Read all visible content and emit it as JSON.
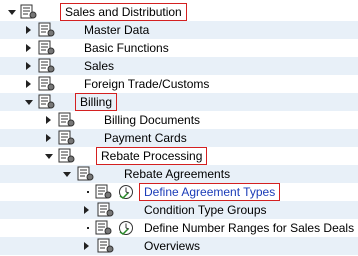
{
  "tree": [
    {
      "label": "Sales and Distribution",
      "level": 0,
      "toggle": "down",
      "boxed": true
    },
    {
      "label": "Master Data",
      "level": 1,
      "toggle": "right"
    },
    {
      "label": "Basic Functions",
      "level": 1,
      "toggle": "right"
    },
    {
      "label": "Sales",
      "level": 1,
      "toggle": "right"
    },
    {
      "label": "Foreign Trade/Customs",
      "level": 1,
      "toggle": "right"
    },
    {
      "label": "Billing",
      "level": 1,
      "toggle": "down",
      "boxed": true
    },
    {
      "label": "Billing Documents",
      "level": 2,
      "toggle": "right"
    },
    {
      "label": "Payment Cards",
      "level": 2,
      "toggle": "right"
    },
    {
      "label": "Rebate Processing",
      "level": 2,
      "toggle": "down",
      "boxed": true
    },
    {
      "label": "Rebate Agreements",
      "level": 3,
      "toggle": "down"
    },
    {
      "label": "Define Agreement Types",
      "level": 4,
      "toggle": "bullet",
      "clock": true,
      "boxed": true,
      "link": true
    },
    {
      "label": "Condition Type Groups",
      "level": 4,
      "toggle": "right"
    },
    {
      "label": "Define Number Ranges for Sales Deals",
      "level": 4,
      "toggle": "bullet",
      "clock": true
    },
    {
      "label": "Overviews",
      "level": 4,
      "toggle": "right"
    }
  ],
  "icons": {
    "node": "document-settings-icon",
    "activity": "clock-check-icon"
  },
  "colors": {
    "box": "#d42020",
    "link": "#1a3cb8",
    "row_alt": "#e8f0f8"
  }
}
